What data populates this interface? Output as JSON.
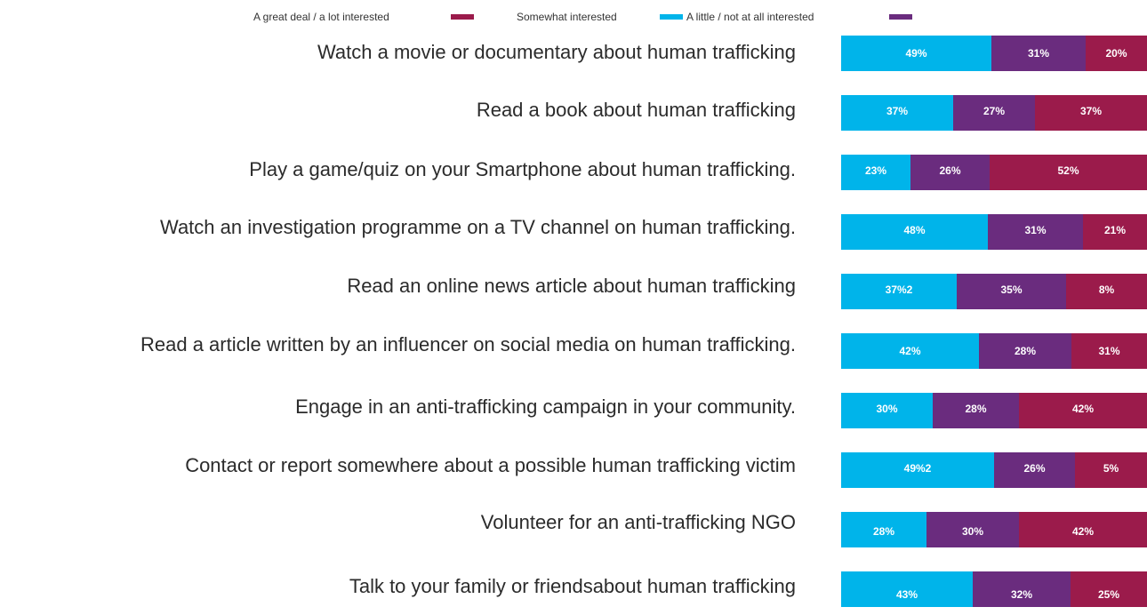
{
  "legend": {
    "items": [
      {
        "label": "A great deal / a lot interested",
        "color": "#9B1B4B"
      },
      {
        "label": "Somewhat interested",
        "color": "#00B4EA"
      },
      {
        "label": "A little / not at all interested",
        "color": "#6A2C7E"
      }
    ]
  },
  "colors": {
    "blue": "#00B4EA",
    "purple": "#6A2C7E",
    "crimson": "#9B1B4B"
  },
  "chart_data": {
    "type": "bar",
    "orientation": "horizontal",
    "stacked": true,
    "categories": [
      "Watch a movie or documentary about human trafficking",
      "Read a book about human trafficking",
      "Play a game/quiz on your Smartphone about human trafficking.",
      "Watch an investigation programme on a TV channel on human trafficking.",
      "Read an online news article about human trafficking",
      "Read a article written by an influencer on social media on human trafficking.",
      "Engage in an anti-trafficking campaign in your community.",
      "Contact or report somewhere about a possible human trafficking victim",
      "Volunteer for an anti-trafficking NGO",
      "Talk to your family or friendsabout human trafficking"
    ],
    "segments": [
      [
        {
          "value": 49,
          "label": "49%",
          "color": "#00B4EA"
        },
        {
          "value": 31,
          "label": "31%",
          "color": "#6A2C7E"
        },
        {
          "value": 20,
          "label": "20%",
          "color": "#9B1B4B"
        }
      ],
      [
        {
          "value": 37,
          "label": "37%",
          "color": "#00B4EA"
        },
        {
          "value": 27,
          "label": "27%",
          "color": "#6A2C7E"
        },
        {
          "value": 37,
          "label": "37%",
          "color": "#9B1B4B"
        }
      ],
      [
        {
          "value": 23,
          "label": "23%",
          "color": "#00B4EA"
        },
        {
          "value": 26,
          "label": "26%",
          "color": "#6A2C7E"
        },
        {
          "value": 52,
          "label": "52%",
          "color": "#9B1B4B"
        }
      ],
      [
        {
          "value": 48,
          "label": "48%",
          "color": "#00B4EA"
        },
        {
          "value": 31,
          "label": "31%",
          "color": "#6A2C7E"
        },
        {
          "value": 21,
          "label": "21%",
          "color": "#9B1B4B"
        }
      ],
      [
        {
          "value": 37,
          "label": "37%2",
          "color": "#00B4EA"
        },
        {
          "value": 35,
          "label": "35%",
          "color": "#6A2C7E"
        },
        {
          "value": 26,
          "label": "8%",
          "color": "#9B1B4B"
        }
      ],
      [
        {
          "value": 42,
          "label": "42%",
          "color": "#00B4EA"
        },
        {
          "value": 28,
          "label": "28%",
          "color": "#6A2C7E"
        },
        {
          "value": 23,
          "label": "31%",
          "color": "#9B1B4B"
        }
      ],
      [
        {
          "value": 30,
          "label": "30%",
          "color": "#00B4EA"
        },
        {
          "value": 28,
          "label": "28%",
          "color": "#6A2C7E"
        },
        {
          "value": 42,
          "label": "42%",
          "color": "#9B1B4B"
        }
      ],
      [
        {
          "value": 49,
          "label": "49%2",
          "color": "#00B4EA"
        },
        {
          "value": 26,
          "label": "26%",
          "color": "#6A2C7E"
        },
        {
          "value": 23,
          "label": "5%",
          "color": "#9B1B4B"
        }
      ],
      [
        {
          "value": 28,
          "label": "28%",
          "color": "#00B4EA"
        },
        {
          "value": 30,
          "label": "30%",
          "color": "#6A2C7E"
        },
        {
          "value": 42,
          "label": "42%",
          "color": "#9B1B4B"
        }
      ],
      [
        {
          "value": 43,
          "label": "43%",
          "color": "#00B4EA"
        },
        {
          "value": 32,
          "label": "32%",
          "color": "#6A2C7E"
        },
        {
          "value": 25,
          "label": "25%",
          "color": "#9B1B4B"
        }
      ]
    ],
    "xlim": [
      0,
      100
    ],
    "grid": false,
    "legend_position": "top"
  }
}
